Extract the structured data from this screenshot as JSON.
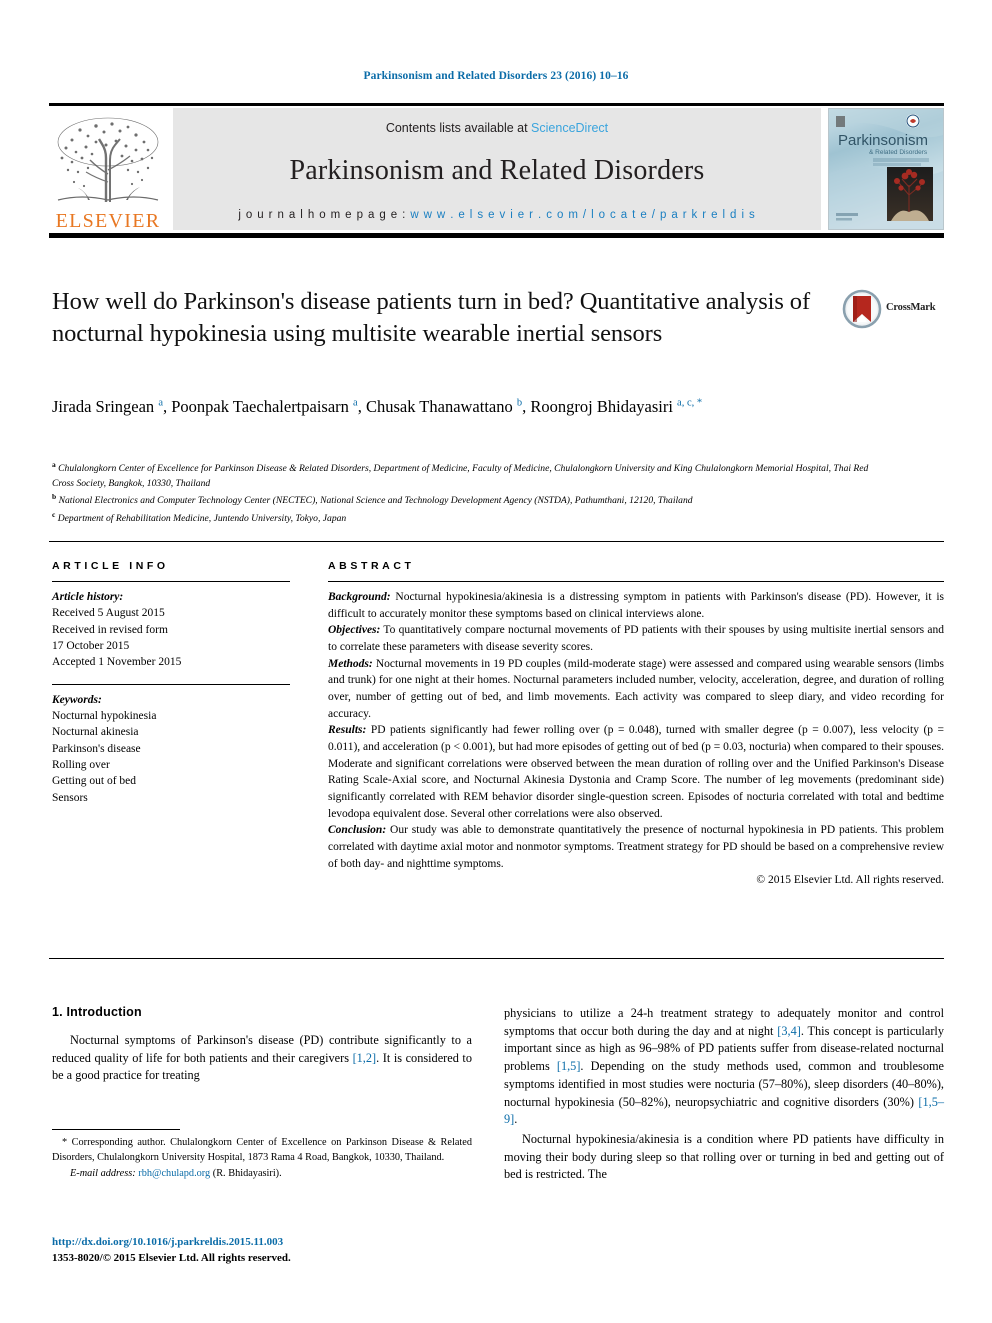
{
  "running_head": "Parkinsonism and Related Disorders 23 (2016) 10–16",
  "masthead": {
    "publisher_name": "ELSEVIER",
    "contents_prefix": "Contents lists available at ",
    "contents_link": "ScienceDirect",
    "journal_title": "Parkinsonism and Related Disorders",
    "homepage_prefix": "j o u r n a l   h o m e p a g e :   ",
    "homepage_url": "w w w . e l s e v i e r . c o m / l o c a t e / p a r k r e l d i s",
    "cover_title": "Parkinsonism",
    "cover_subtitle": "& Related Disorders"
  },
  "article": {
    "title": "How well do Parkinson's disease patients turn in bed? Quantitative analysis of nocturnal hypokinesia using multisite wearable inertial sensors",
    "crossmark_label": "CrossMark",
    "authors": [
      {
        "name": "Jirada Sringean",
        "marks": "a",
        "sep": ", "
      },
      {
        "name": "Poonpak Taechalertpaisarn",
        "marks": "a",
        "sep": ", "
      },
      {
        "name": "Chusak Thanawattano",
        "marks": "b",
        "sep": ", "
      },
      {
        "name": "Roongroj Bhidayasiri",
        "marks": "a, c, *",
        "sep": ""
      }
    ],
    "affiliations": [
      {
        "mark": "a",
        "text": "Chulalongkorn Center of Excellence for Parkinson Disease & Related Disorders, Department of Medicine, Faculty of Medicine, Chulalongkorn University and King Chulalongkorn Memorial Hospital, Thai Red Cross Society, Bangkok, 10330, Thailand"
      },
      {
        "mark": "b",
        "text": "National Electronics and Computer Technology Center (NECTEC), National Science and Technology Development Agency (NSTDA), Pathumthani, 12120, Thailand"
      },
      {
        "mark": "c",
        "text": "Department of Rehabilitation Medicine, Juntendo University, Tokyo, Japan"
      }
    ]
  },
  "article_info": {
    "heading": "ARTICLE INFO",
    "history_label": "Article history:",
    "history_lines": [
      "Received 5 August 2015",
      "Received in revised form",
      "17 October 2015",
      "Accepted 1 November 2015"
    ],
    "keywords_label": "Keywords:",
    "keywords": [
      "Nocturnal hypokinesia",
      "Nocturnal akinesia",
      "Parkinson's disease",
      "Rolling over",
      "Getting out of bed",
      "Sensors"
    ]
  },
  "abstract": {
    "heading": "ABSTRACT",
    "sections": [
      {
        "label": "Background:",
        "text": " Nocturnal hypokinesia/akinesia is a distressing symptom in patients with Parkinson's disease (PD). However, it is difficult to accurately monitor these symptoms based on clinical interviews alone."
      },
      {
        "label": "Objectives:",
        "text": " To quantitatively compare nocturnal movements of PD patients with their spouses by using multisite inertial sensors and to correlate these parameters with disease severity scores."
      },
      {
        "label": "Methods:",
        "text": " Nocturnal movements in 19 PD couples (mild-moderate stage) were assessed and compared using wearable sensors (limbs and trunk) for one night at their homes. Nocturnal parameters included number, velocity, acceleration, degree, and duration of rolling over, number of getting out of bed, and limb movements. Each activity was compared to sleep diary, and video recording for accuracy."
      },
      {
        "label": "Results:",
        "text": " PD patients significantly had fewer rolling over (p = 0.048), turned with smaller degree (p = 0.007), less velocity (p = 0.011), and acceleration (p < 0.001), but had more episodes of getting out of bed (p = 0.03, nocturia) when compared to their spouses. Moderate and significant correlations were observed between the mean duration of rolling over and the Unified Parkinson's Disease Rating Scale-Axial score, and Nocturnal Akinesia Dystonia and Cramp Score. The number of leg movements (predominant side) significantly correlated with REM behavior disorder single-question screen. Episodes of nocturia correlated with total and bedtime levodopa equivalent dose. Several other correlations were also observed."
      },
      {
        "label": "Conclusion:",
        "text": " Our study was able to demonstrate quantitatively the presence of nocturnal hypokinesia in PD patients. This problem correlated with daytime axial motor and nonmotor symptoms. Treatment strategy for PD should be based on a comprehensive review of both day- and nighttime symptoms."
      }
    ],
    "copyright": "© 2015 Elsevier Ltd. All rights reserved."
  },
  "body": {
    "section_heading": "1. Introduction",
    "left_paragraph_parts": [
      {
        "t": "Nocturnal symptoms of Parkinson's disease (PD) contribute significantly to a reduced quality of life for both patients and their caregivers "
      },
      {
        "t": "[1,2]",
        "ref": true
      },
      {
        "t": ". It is considered to be a good practice for treating"
      }
    ],
    "right_paragraph1_parts": [
      {
        "t": "physicians to utilize a 24-h treatment strategy to adequately monitor and control symptoms that occur both during the day and at night "
      },
      {
        "t": "[3,4]",
        "ref": true
      },
      {
        "t": ". This concept is particularly important since as high as 96–98% of PD patients suffer from disease-related nocturnal problems "
      },
      {
        "t": "[1,5]",
        "ref": true
      },
      {
        "t": ". Depending on the study methods used, common and troublesome symptoms identified in most studies were nocturia (57–80%), sleep disorders (40–80%), nocturnal hypokinesia (50–82%), neuropsychiatric and cognitive disorders (30%) "
      },
      {
        "t": "[1,5–9]",
        "ref": true
      },
      {
        "t": "."
      }
    ],
    "right_paragraph2_parts": [
      {
        "t": "Nocturnal hypokinesia/akinesia is a condition where PD patients have difficulty in moving their body during sleep so that rolling over or turning in bed and getting out of bed is restricted. The"
      }
    ]
  },
  "footnotes": {
    "corresponding_mark": "*",
    "corresponding_text": " Corresponding author. Chulalongkorn Center of Excellence on Parkinson Disease & Related Disorders, Chulalongkorn University Hospital, 1873 Rama 4 Road, Bangkok, 10330, Thailand.",
    "email_label": "E-mail address:",
    "email": "rbh@chulapd.org",
    "email_suffix": " (R. Bhidayasiri)."
  },
  "doi_block": {
    "doi_url": "http://dx.doi.org/10.1016/j.parkreldis.2015.11.003",
    "issn_line": "1353-8020/© 2015 Elsevier Ltd. All rights reserved."
  },
  "colors": {
    "link_blue": "#0b6ca8",
    "sciencedirect_blue": "#3aa4dd",
    "elsevier_orange": "#e87722",
    "masthead_grey": "#e6e6e6",
    "crossmark_red": "#b5271e",
    "crossmark_ring": "#7e96a8"
  }
}
